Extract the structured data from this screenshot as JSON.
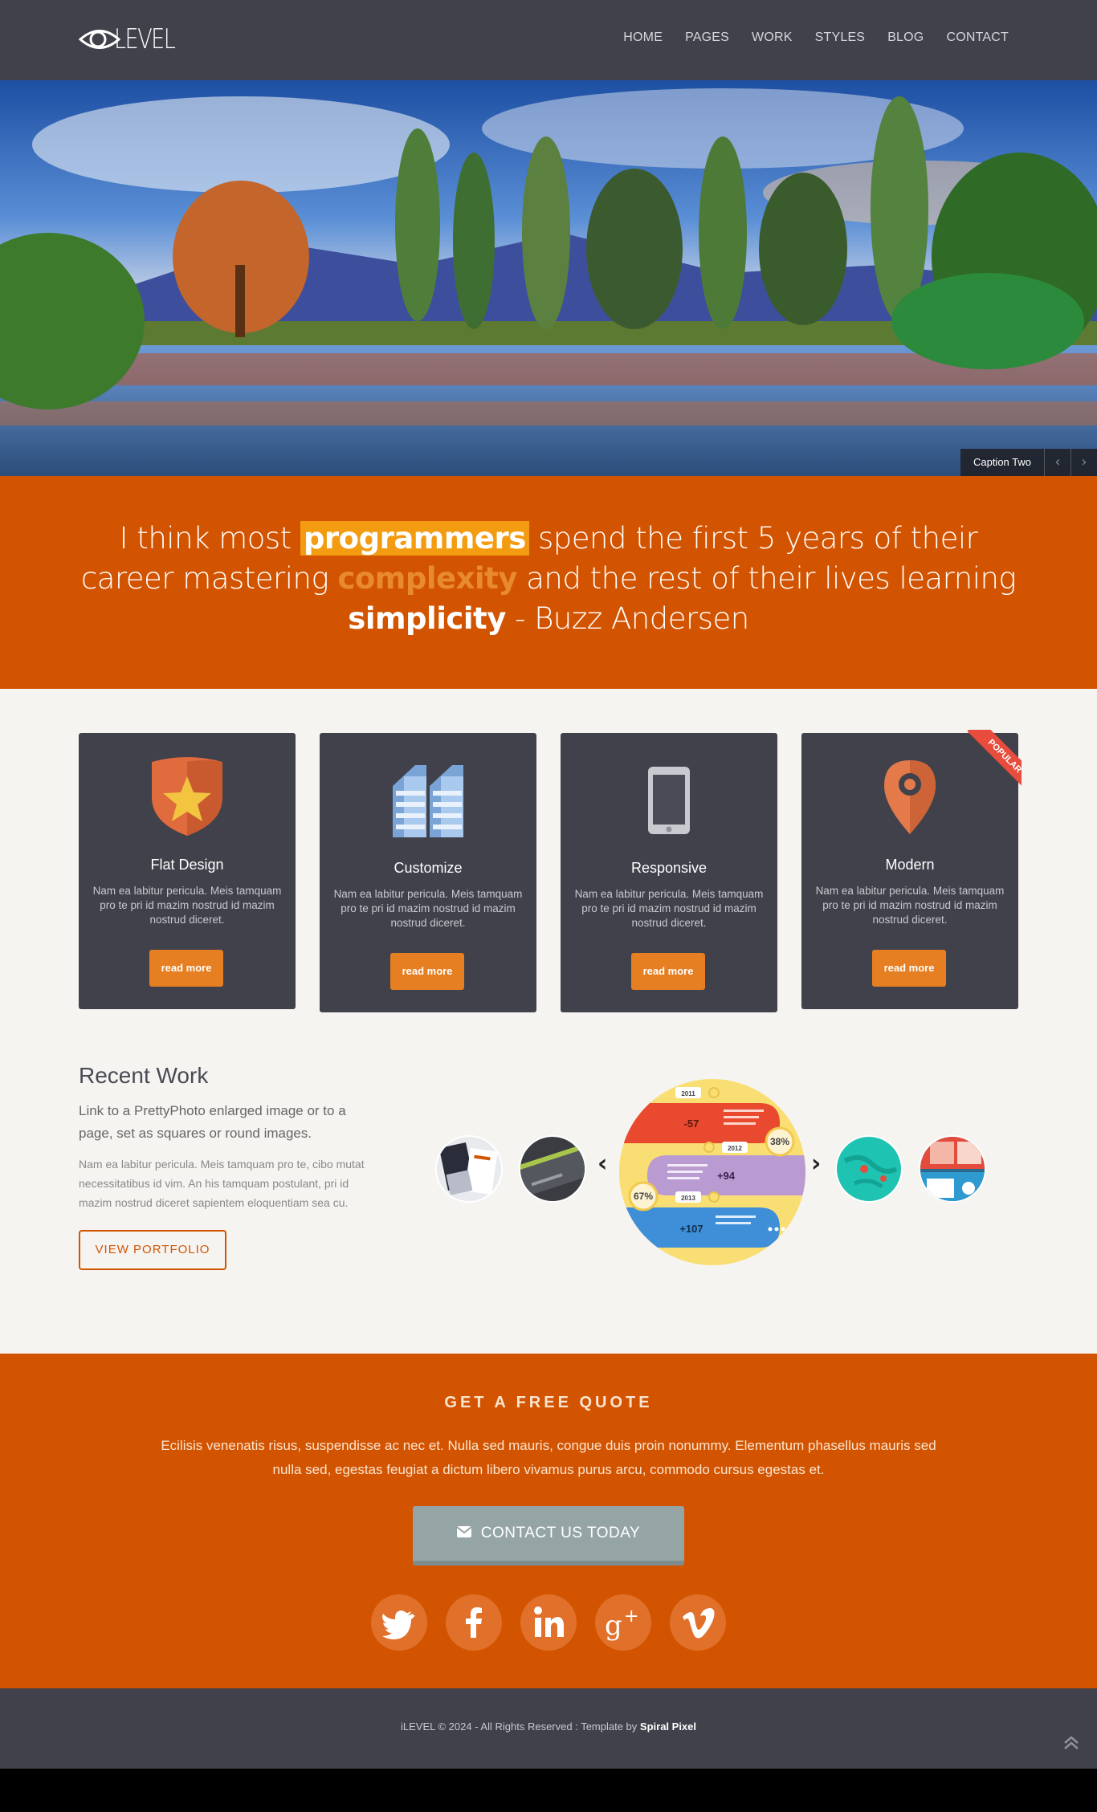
{
  "header": {
    "logo_text": "LEVEL",
    "nav": [
      "HOME",
      "PAGES",
      "WORK",
      "STYLES",
      "BLOG",
      "CONTACT"
    ]
  },
  "hero": {
    "caption": "Caption Two",
    "prev_icon": "chevron-left-icon",
    "next_icon": "chevron-right-icon"
  },
  "quote": {
    "part1": "I think most ",
    "highlight1": "programmers",
    "part2": " spend the first 5 years of their career mastering ",
    "highlight2": "complexity",
    "part3": " and the rest of their lives learning ",
    "highlight3": "simplicity",
    "part4": " - Buzz Andersen"
  },
  "features": [
    {
      "title": "Flat Design",
      "text": "Nam ea labitur pericula. Meis tamquam pro te pri id mazim nostrud id mazim nostrud diceret.",
      "button": "read more",
      "icon": "shield-star-icon"
    },
    {
      "title": "Customize",
      "text": "Nam ea labitur pericula. Meis tamquam pro te pri id mazim nostrud id mazim nostrud diceret.",
      "button": "read more",
      "icon": "buildings-icon"
    },
    {
      "title": "Responsive",
      "text": "Nam ea labitur pericula. Meis tamquam pro te pri id mazim nostrud id mazim nostrud diceret.",
      "button": "read more",
      "icon": "phone-icon"
    },
    {
      "title": "Modern",
      "text": "Nam ea labitur pericula. Meis tamquam pro te pri id mazim nostrud id mazim nostrud diceret.",
      "button": "read more",
      "icon": "map-pin-icon",
      "badge": "POPULAR"
    }
  ],
  "recent_work": {
    "title": "Recent Work",
    "subtitle": "Link to a PrettyPhoto enlarged image or to a page, set as squares or round images.",
    "text": "Nam ea labitur pericula. Meis tamquam pro te, cibo mutat necessitatibus id vim. An his tamquam postulant, pri id mazim nostrud diceret sapientem eloquentiam sea cu.",
    "button": "VIEW PORTFOLIO",
    "featured": {
      "years": [
        "2011",
        "2012",
        "2013"
      ],
      "values": [
        "-57",
        "+94",
        "+107"
      ],
      "percents": [
        "38%",
        "67%"
      ]
    }
  },
  "cta": {
    "title": "GET A FREE QUOTE",
    "text": "Ecilisis venenatis risus, suspendisse ac nec et. Nulla sed mauris, congue duis proin nonummy. Elementum phasellus mauris sed nulla sed, egestas feugiat a dictum libero vivamus purus arcu, commodo cursus egestas et.",
    "button": "CONTACT US TODAY",
    "social": [
      "twitter-icon",
      "facebook-icon",
      "linkedin-icon",
      "google-plus-icon",
      "vimeo-icon"
    ]
  },
  "footer": {
    "copyright": "iLEVEL © 2024 - All Rights Reserved : Template by ",
    "author": "Spiral Pixel"
  },
  "colors": {
    "header": "#40414b",
    "accent": "#d35400",
    "button": "#e67e22",
    "page_bg": "#f6f4f1"
  }
}
